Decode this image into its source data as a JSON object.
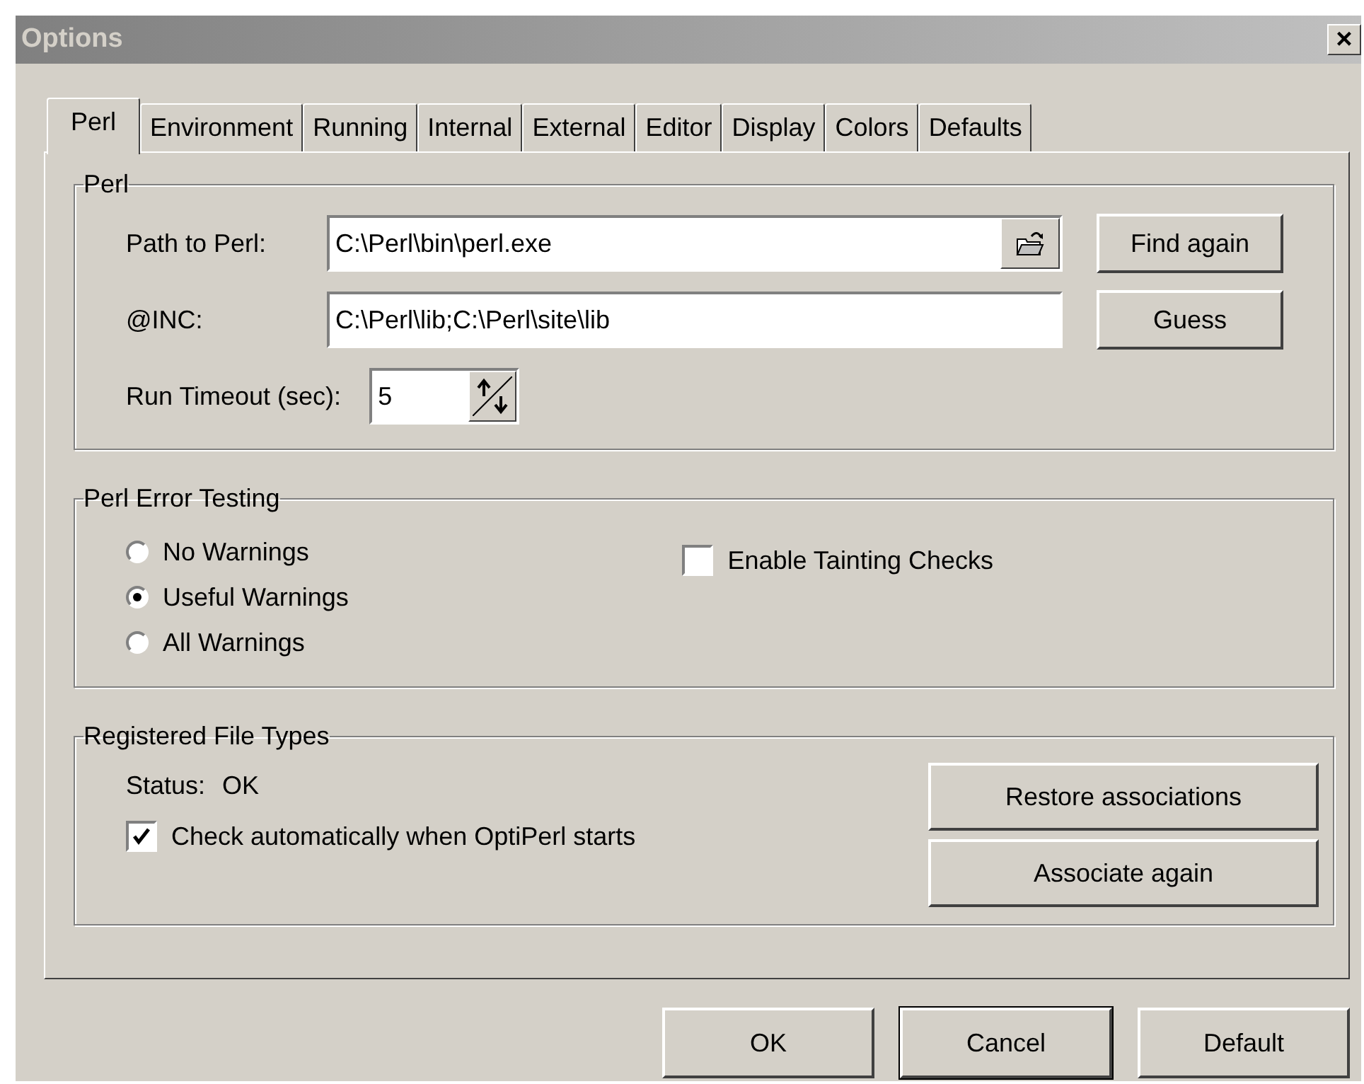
{
  "window": {
    "title": "Options",
    "close": "×"
  },
  "tabs": [
    {
      "label": "Perl",
      "selected": true
    },
    {
      "label": "Environment",
      "selected": false
    },
    {
      "label": "Running",
      "selected": false
    },
    {
      "label": "Internal",
      "selected": false
    },
    {
      "label": "External",
      "selected": false
    },
    {
      "label": "Editor",
      "selected": false
    },
    {
      "label": "Display",
      "selected": false
    },
    {
      "label": "Colors",
      "selected": false
    },
    {
      "label": "Defaults",
      "selected": false
    }
  ],
  "perl_group": {
    "title": "Perl",
    "path_label": "Path to Perl:",
    "path_value": "C:\\Perl\\bin\\perl.exe",
    "find_again": "Find again",
    "inc_label": "@INC:",
    "inc_value": "C:\\Perl\\lib;C:\\Perl\\site\\lib",
    "guess": "Guess",
    "timeout_label": "Run Timeout (sec):",
    "timeout_value": "5"
  },
  "error_group": {
    "title": "Perl Error Testing",
    "radios": [
      {
        "label": "No Warnings",
        "selected": false
      },
      {
        "label": "Useful Warnings",
        "selected": true
      },
      {
        "label": "All Warnings",
        "selected": false
      }
    ],
    "tainting": {
      "label": "Enable Tainting Checks",
      "checked": false
    }
  },
  "file_types_group": {
    "title": "Registered File Types",
    "status_label": "Status:",
    "status_value": "OK",
    "auto_check": {
      "label": "Check automatically when OptiPerl starts",
      "checked": true
    },
    "restore": "Restore associations",
    "associate": "Associate again"
  },
  "buttons": [
    {
      "label": "OK",
      "default": false
    },
    {
      "label": "Cancel",
      "default": true
    },
    {
      "label": "Default",
      "default": false
    }
  ]
}
